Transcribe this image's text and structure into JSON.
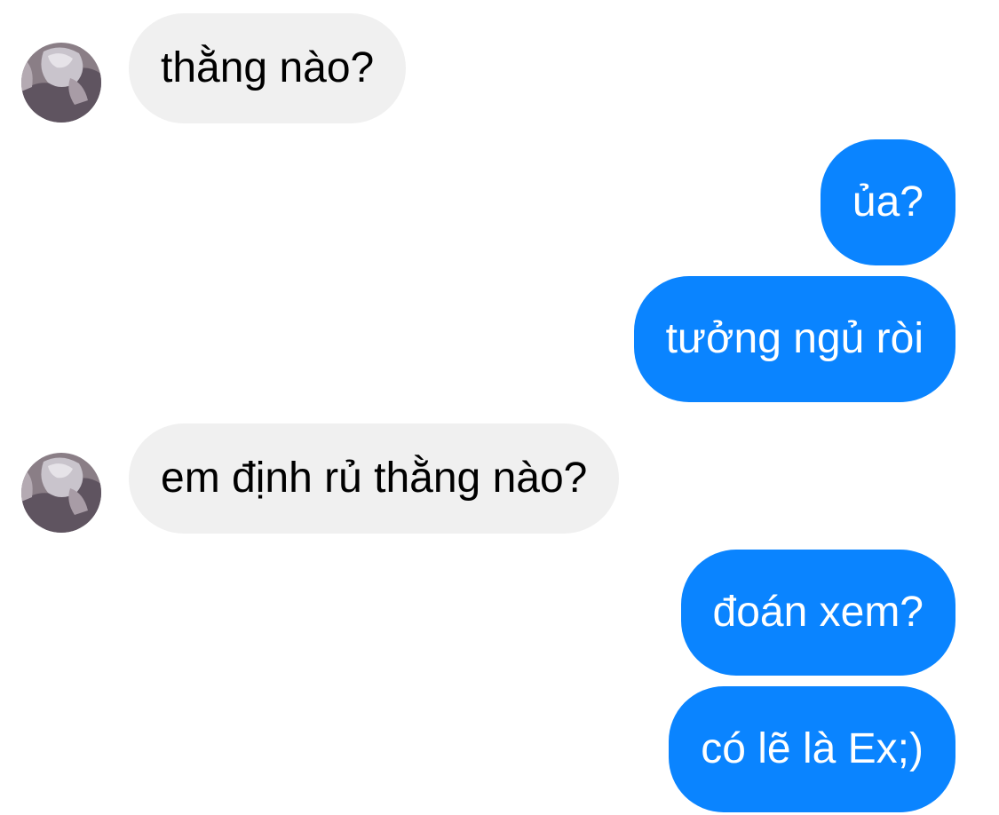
{
  "colors": {
    "incoming_bubble": "#f0f0f0",
    "outgoing_bubble": "#0a84ff",
    "incoming_text": "#000000",
    "outgoing_text": "#ffffff"
  },
  "messages": [
    {
      "direction": "incoming",
      "text": "thằng nào?",
      "avatar": "contact-avatar"
    },
    {
      "direction": "outgoing",
      "text": "ủa?"
    },
    {
      "direction": "outgoing",
      "text": "tưởng ngủ ròi"
    },
    {
      "direction": "incoming",
      "text": "em định rủ thằng nào?",
      "avatar": "contact-avatar"
    },
    {
      "direction": "outgoing",
      "text": "đoán xem?"
    },
    {
      "direction": "outgoing",
      "text": "có lẽ là Ex;)"
    }
  ]
}
